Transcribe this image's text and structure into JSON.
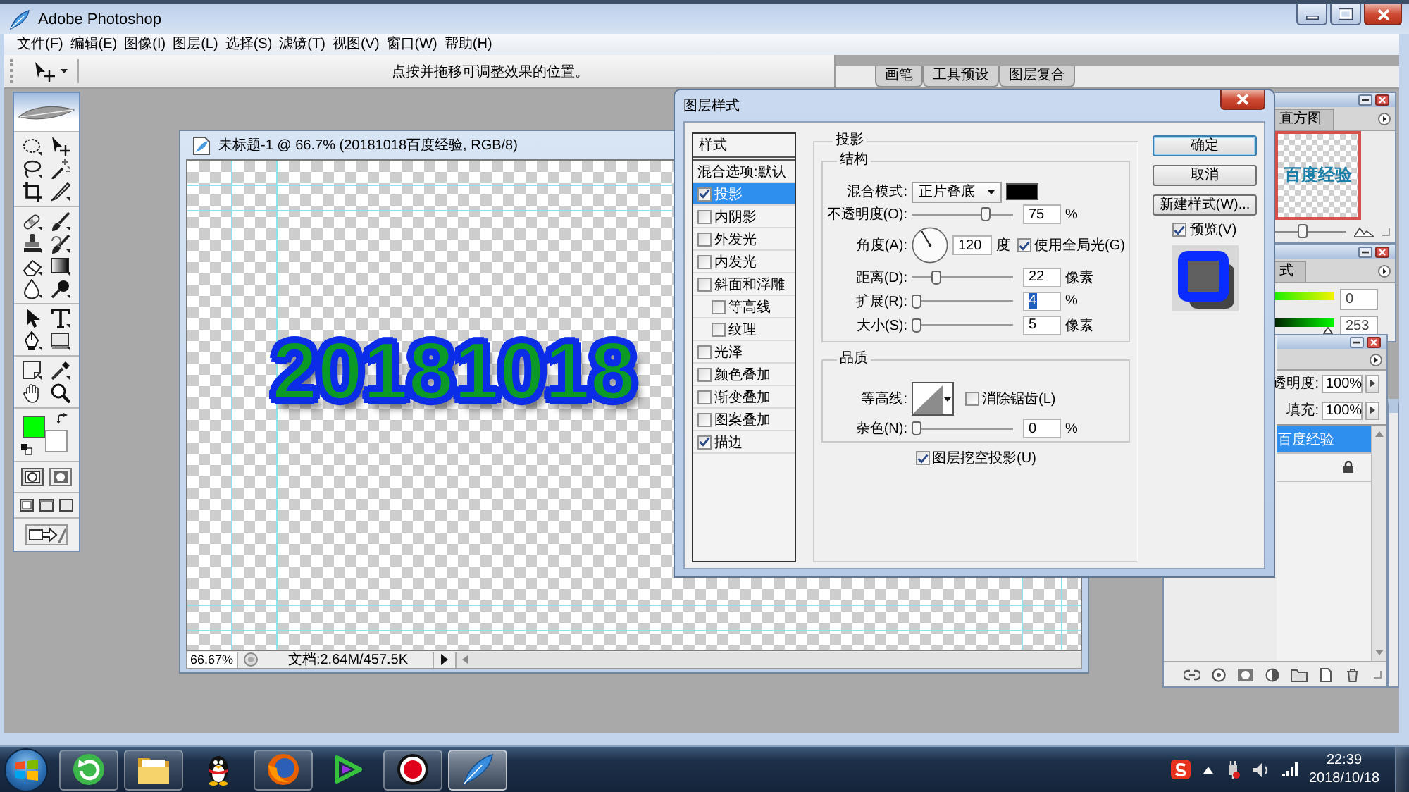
{
  "window": {
    "title": "Adobe Photoshop"
  },
  "menu": [
    "文件(F)",
    "编辑(E)",
    "图像(I)",
    "图层(L)",
    "选择(S)",
    "滤镜(T)",
    "视图(V)",
    "窗口(W)",
    "帮助(H)"
  ],
  "options_bar": {
    "hint": "点按并拖移可调整效果的位置。",
    "palette_tabs": [
      "画笔",
      "工具预设",
      "图层复合"
    ]
  },
  "document": {
    "title": "未标题-1 @ 66.7% (20181018百度经验, RGB/8)",
    "canvas_text": "20181018",
    "zoom": "66.67%",
    "doc_size": "文档:2.64M/457.5K"
  },
  "dialog": {
    "title": "图层样式",
    "list_header": "样式",
    "blend_options": {
      "label": "混合选项:默认",
      "selected": false
    },
    "effects": [
      {
        "label": "投影",
        "checked": true,
        "selected": true
      },
      {
        "label": "内阴影",
        "checked": false,
        "selected": false
      },
      {
        "label": "外发光",
        "checked": false,
        "selected": false
      },
      {
        "label": "内发光",
        "checked": false,
        "selected": false
      },
      {
        "label": "斜面和浮雕",
        "checked": false,
        "selected": false,
        "children": [
          {
            "label": "等高线",
            "checked": false,
            "selected": false
          },
          {
            "label": "纹理",
            "checked": false,
            "selected": false
          }
        ]
      },
      {
        "label": "光泽",
        "checked": false,
        "selected": false
      },
      {
        "label": "颜色叠加",
        "checked": false,
        "selected": false
      },
      {
        "label": "渐变叠加",
        "checked": false,
        "selected": false
      },
      {
        "label": "图案叠加",
        "checked": false,
        "selected": false
      },
      {
        "label": "描边",
        "checked": true,
        "selected": false
      }
    ],
    "drop_shadow": {
      "title": "投影",
      "structure": {
        "title": "结构",
        "rows": [
          {
            "kind": "select",
            "label": "混合模式:",
            "value": "正片叠底",
            "color": "#000000"
          },
          {
            "kind": "slider",
            "label": "不透明度(O):",
            "level": 0.75,
            "value": "75",
            "unit": "%",
            "focused": false
          },
          {
            "kind": "angle",
            "label": "角度(A):",
            "value": "120",
            "unit": "度",
            "option": {
              "label": "使用全局光(G)",
              "checked": true
            }
          },
          {
            "kind": "slider",
            "label": "距离(D):",
            "level": 0.22,
            "value": "22",
            "unit": "像素",
            "focused": false
          },
          {
            "kind": "slider",
            "label": "扩展(R):",
            "level": 0,
            "value": "4",
            "unit": "%",
            "focused": true
          },
          {
            "kind": "slider",
            "label": "大小(S):",
            "level": 0,
            "value": "5",
            "unit": "像素",
            "focused": false
          }
        ]
      },
      "quality": {
        "title": "品质",
        "rows": [
          {
            "kind": "contour",
            "label": "等高线:",
            "option": {
              "label": "消除锯齿(L)",
              "checked": false
            }
          },
          {
            "kind": "slider",
            "label": "杂色(N):",
            "level": 0,
            "value": "0",
            "unit": "%",
            "focused": false
          }
        ]
      },
      "knockout": {
        "label": "图层挖空投影(U)",
        "checked": true
      }
    },
    "buttons": [
      {
        "label": "确定",
        "default": true
      },
      {
        "label": "取消",
        "default": false
      },
      {
        "label": "新建样式(W)...",
        "default": false
      }
    ],
    "preview": {
      "label": "预览(V)",
      "checked": true
    }
  },
  "navigator": {
    "tabs": [
      {
        "label": "直方图",
        "selected": false
      }
    ],
    "thumbnail_text": "百度经验",
    "zoom_slider": {
      "level": 0.38
    }
  },
  "color_panel": {
    "tabs": [
      {
        "label": "式",
        "selected": false
      }
    ],
    "sliders": [
      {
        "value": "0"
      },
      {
        "value": "253",
        "level": 0.98
      }
    ]
  },
  "layers_panel": {
    "opacity_label": "透明度:",
    "opacity": "100%",
    "fill_label": "填充:",
    "fill": "100%",
    "layers": [
      {
        "name": "百度经验",
        "selected": true,
        "locked": false
      },
      {
        "selected": false,
        "locked": true
      }
    ]
  },
  "taskbar": {
    "apps": [
      {
        "running": true,
        "selected": false
      },
      {
        "running": true,
        "selected": false
      },
      {
        "running": false,
        "selected": false
      },
      {
        "running": true,
        "selected": false
      },
      {
        "running": false,
        "selected": false
      },
      {
        "running": true,
        "selected": false
      },
      {
        "running": true,
        "selected": true
      }
    ],
    "time": "22:39",
    "date": "2018/10/18"
  }
}
